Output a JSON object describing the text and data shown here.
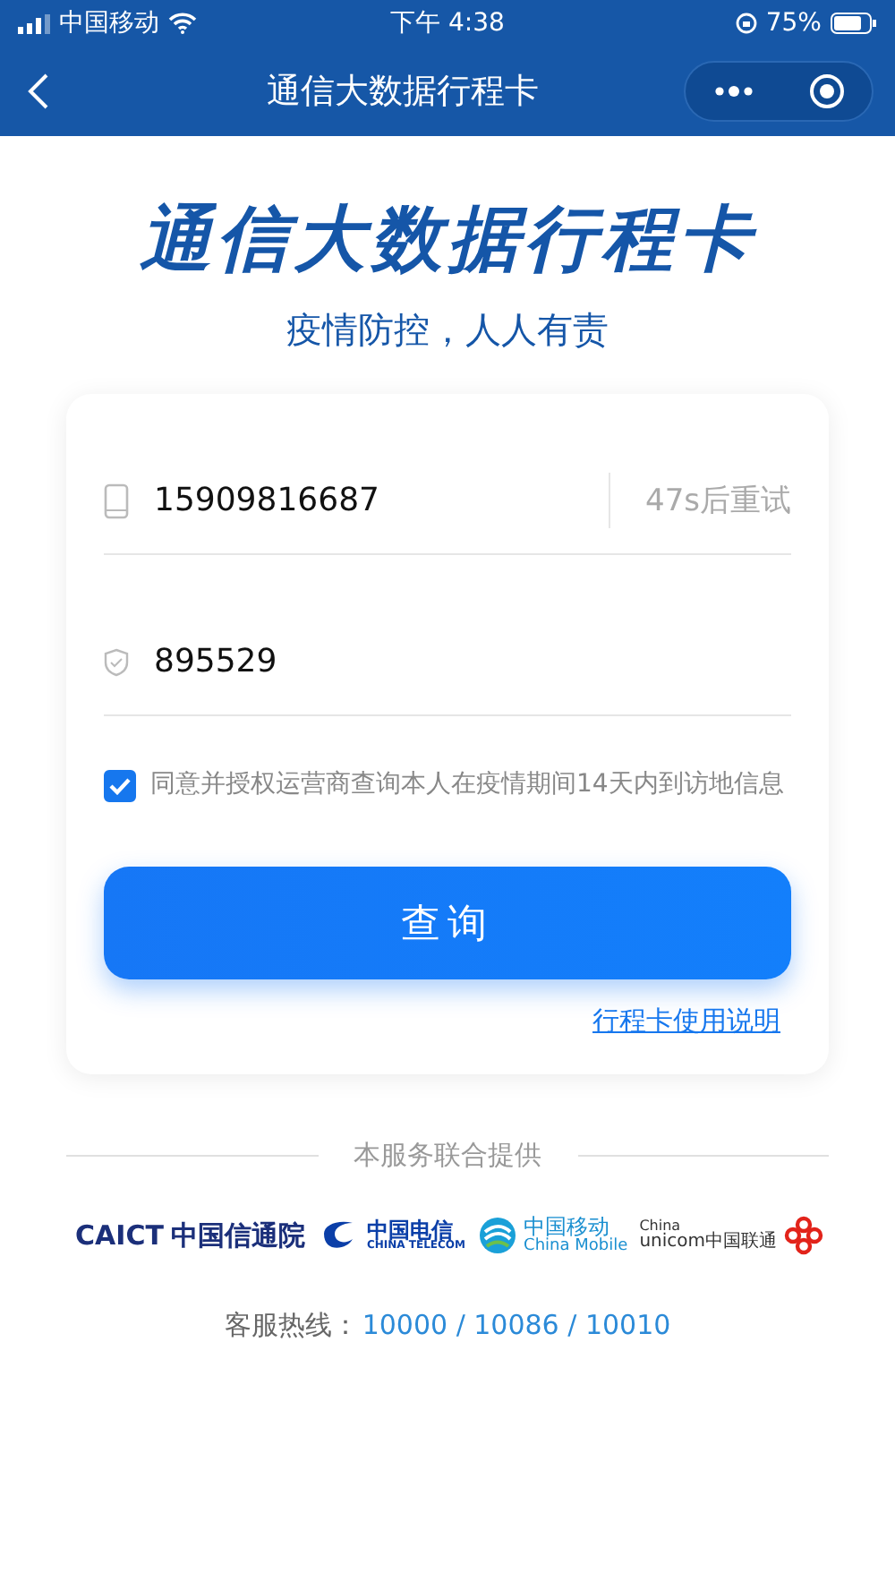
{
  "status_bar": {
    "carrier": "中国移动",
    "time": "下午 4:38",
    "battery": "75%"
  },
  "nav_bar": {
    "title": "通信大数据行程卡"
  },
  "hero": {
    "title": "通信大数据行程卡",
    "subtitle": "疫情防控，人人有责"
  },
  "form": {
    "phone": {
      "value": "15909816687",
      "resend": "47s后重试",
      "resend_disabled": true
    },
    "code": {
      "value": "895529"
    },
    "consent": {
      "checked": true,
      "text": "同意并授权运营商查询本人在疫情期间14天内到访地信息"
    },
    "submit": "查询",
    "help_link": "行程卡使用说明"
  },
  "providers": {
    "heading": "本服务联合提供",
    "logos": [
      {
        "kind": "caict",
        "texts": [
          "CAICT",
          "中国信通院"
        ]
      },
      {
        "kind": "telecom",
        "texts": [
          "中国电信",
          "CHINA TELECOM"
        ]
      },
      {
        "kind": "mobile",
        "texts": [
          "中国移动",
          "China Mobile"
        ]
      },
      {
        "kind": "unicom",
        "texts": [
          "China",
          "unicom中国联通"
        ]
      }
    ]
  },
  "hotline": {
    "label": "客服热线：",
    "numbers": "10000 / 10086 / 10010"
  }
}
